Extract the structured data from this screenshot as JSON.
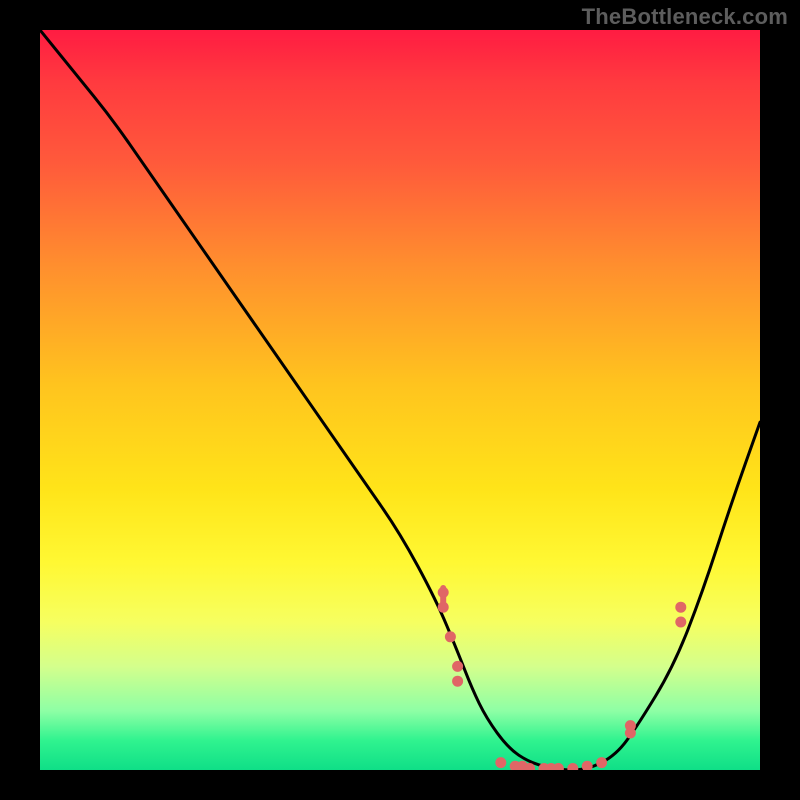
{
  "watermark": "TheBottleneck.com",
  "colors": {
    "background": "#000000",
    "curve": "#000000",
    "points": "#e06666",
    "gradient_top": "#ff1c42",
    "gradient_bottom": "#0fdf87"
  },
  "chart_data": {
    "type": "line",
    "title": "",
    "xlabel": "",
    "ylabel": "",
    "xlim": [
      0,
      100
    ],
    "ylim": [
      0,
      100
    ],
    "series": [
      {
        "name": "bottleneck-curve",
        "x": [
          0,
          5,
          10,
          15,
          20,
          25,
          30,
          35,
          40,
          45,
          50,
          55,
          58,
          60,
          62,
          65,
          68,
          72,
          76,
          80,
          83,
          88,
          92,
          96,
          100
        ],
        "y": [
          100,
          94,
          88,
          81,
          74,
          67,
          60,
          53,
          46,
          39,
          32,
          23,
          16,
          11,
          7,
          3,
          1,
          0,
          0,
          2,
          6,
          14,
          24,
          36,
          47
        ]
      }
    ],
    "points": [
      {
        "x": 56,
        "y": 24
      },
      {
        "x": 56,
        "y": 22
      },
      {
        "x": 57,
        "y": 18
      },
      {
        "x": 58,
        "y": 14
      },
      {
        "x": 58,
        "y": 12
      },
      {
        "x": 64,
        "y": 1
      },
      {
        "x": 66,
        "y": 0.5
      },
      {
        "x": 67,
        "y": 0.5
      },
      {
        "x": 68,
        "y": 0.2
      },
      {
        "x": 70,
        "y": 0.2
      },
      {
        "x": 71,
        "y": 0.2
      },
      {
        "x": 72,
        "y": 0.2
      },
      {
        "x": 74,
        "y": 0.2
      },
      {
        "x": 76,
        "y": 0.5
      },
      {
        "x": 78,
        "y": 1
      },
      {
        "x": 82,
        "y": 5
      },
      {
        "x": 82,
        "y": 6
      },
      {
        "x": 89,
        "y": 20
      },
      {
        "x": 89,
        "y": 22
      }
    ],
    "point_bars": [
      {
        "x": 56,
        "y": 22,
        "h": 3
      }
    ]
  }
}
